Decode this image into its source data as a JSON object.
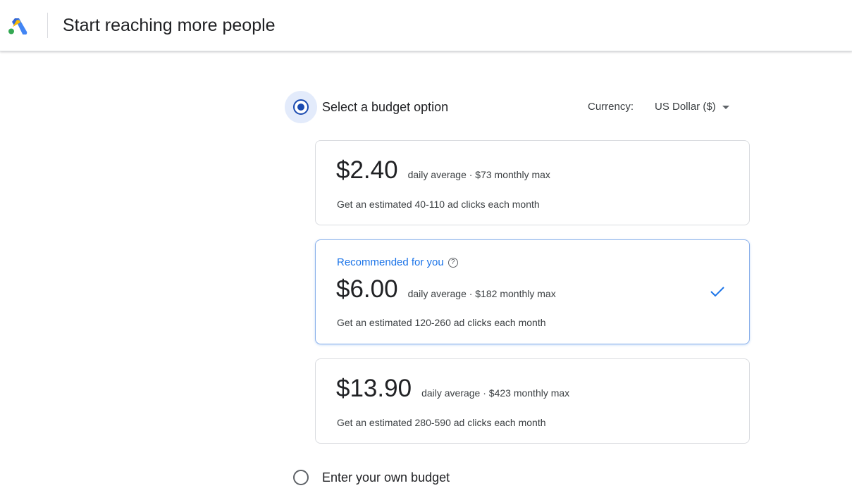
{
  "header": {
    "title": "Start reaching more people",
    "logo_icon": "google-ads-logo"
  },
  "budget": {
    "select_option_label": "Select a budget option",
    "select_option_checked": true,
    "currency_label": "Currency:",
    "currency_value": "US Dollar ($)",
    "options": [
      {
        "recommended": false,
        "price": "$2.40",
        "meta": "daily average ·  $73 monthly max",
        "estimate": "Get an estimated 40-110 ad clicks each month"
      },
      {
        "recommended": true,
        "recommended_label": "Recommended for you",
        "price": "$6.00",
        "meta": "daily average ·  $182 monthly max",
        "estimate": "Get an estimated 120-260 ad clicks each month",
        "selected": true
      },
      {
        "recommended": false,
        "price": "$13.90",
        "meta": "daily average ·  $423 monthly max",
        "estimate": "Get an estimated 280-590 ad clicks each month"
      }
    ],
    "own_budget_label": "Enter your own budget",
    "own_budget_checked": false
  },
  "colors": {
    "accent": "#1a73e8",
    "radio_checked": "#1a4ab0",
    "selected_border": "#8ab0ea"
  }
}
